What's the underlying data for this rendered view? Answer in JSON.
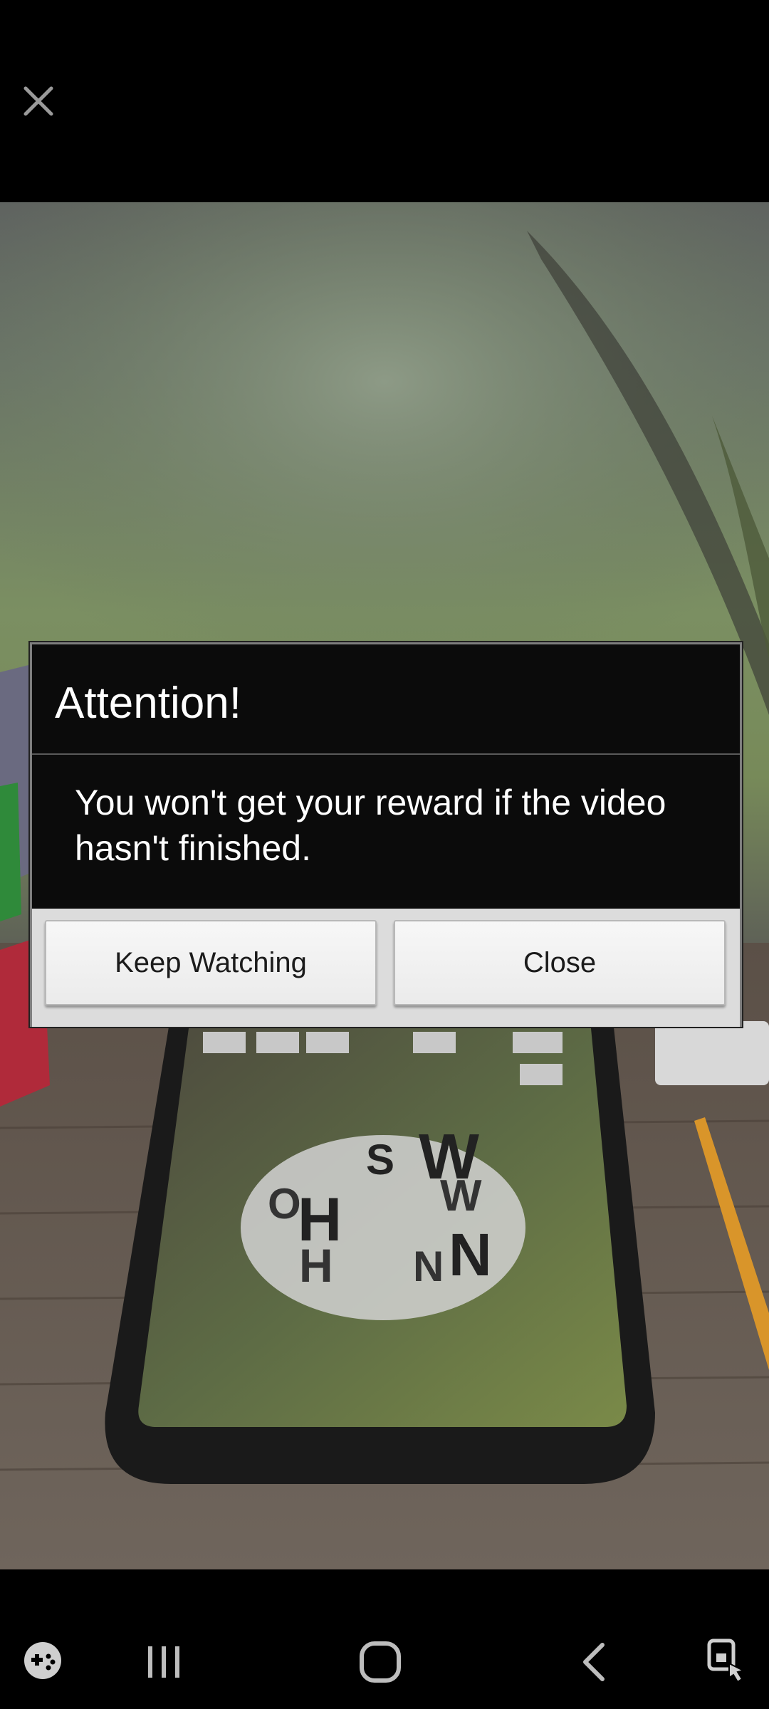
{
  "dialog": {
    "title": "Attention!",
    "message": "You won't get your reward if the video hasn't finished.",
    "buttons": {
      "keep_watching": "Keep Watching",
      "close": "Close"
    }
  },
  "video": {
    "letters": [
      "S",
      "W",
      "W",
      "H",
      "H",
      "N",
      "N",
      "O"
    ]
  },
  "icons": {
    "close_ad": "close-icon",
    "game_launcher": "game-launcher-icon",
    "recents": "recents-icon",
    "home": "home-icon",
    "back": "back-icon",
    "accessibility": "accessibility-icon"
  },
  "colors": {
    "dialog_bg": "#0b0b0b",
    "button_bar_bg": "#dcdcdc",
    "button_text": "#1b1b1b"
  }
}
